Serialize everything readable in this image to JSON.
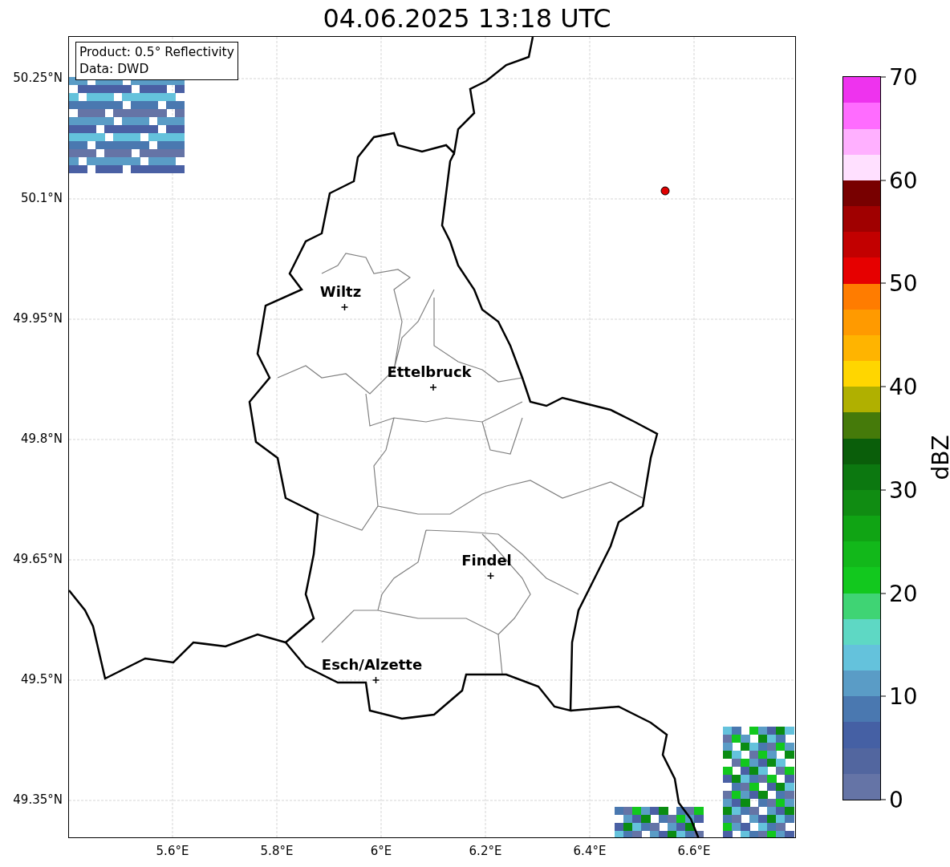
{
  "title": "04.06.2025 13:18 UTC",
  "info_box": [
    "Product: 0.5° Reflectivity",
    "Data: DWD"
  ],
  "lat_labels": [
    "50.25°N",
    "50.1°N",
    "49.95°N",
    "49.8°N",
    "49.65°N",
    "49.5°N",
    "49.35°N"
  ],
  "lon_labels": [
    "5.6°E",
    "5.8°E",
    "6°E",
    "6.2°E",
    "6.4°E",
    "6.6°E"
  ],
  "cities": [
    "Wiltz",
    "Ettelbruck",
    "Findel",
    "Esch/Alzette"
  ],
  "colorbar": {
    "label": "dBZ",
    "ticks": [
      "70",
      "60",
      "50",
      "40",
      "30",
      "20",
      "10",
      "0"
    ],
    "segments": [
      {
        "color": "#6574a6"
      },
      {
        "color": "#52669f"
      },
      {
        "color": "#4560a4"
      },
      {
        "color": "#4a78b0"
      },
      {
        "color": "#5a9cc6"
      },
      {
        "color": "#64c2dc"
      },
      {
        "color": "#5ed8c4"
      },
      {
        "color": "#3fd474"
      },
      {
        "color": "#12c81e"
      },
      {
        "color": "#12b81a"
      },
      {
        "color": "#10a414"
      },
      {
        "color": "#108c12"
      },
      {
        "color": "#0c7810"
      },
      {
        "color": "#0a5e0a"
      },
      {
        "color": "#457a0a"
      },
      {
        "color": "#b0b000"
      },
      {
        "color": "#ffd600"
      },
      {
        "color": "#ffb400"
      },
      {
        "color": "#ff9a00"
      },
      {
        "color": "#ff7c00"
      },
      {
        "color": "#e60000"
      },
      {
        "color": "#c20000"
      },
      {
        "color": "#a00000"
      },
      {
        "color": "#780000"
      },
      {
        "color": "#ffe0ff"
      },
      {
        "color": "#ffb0ff"
      },
      {
        "color": "#ff6cff"
      },
      {
        "color": "#ee33ee"
      }
    ]
  }
}
